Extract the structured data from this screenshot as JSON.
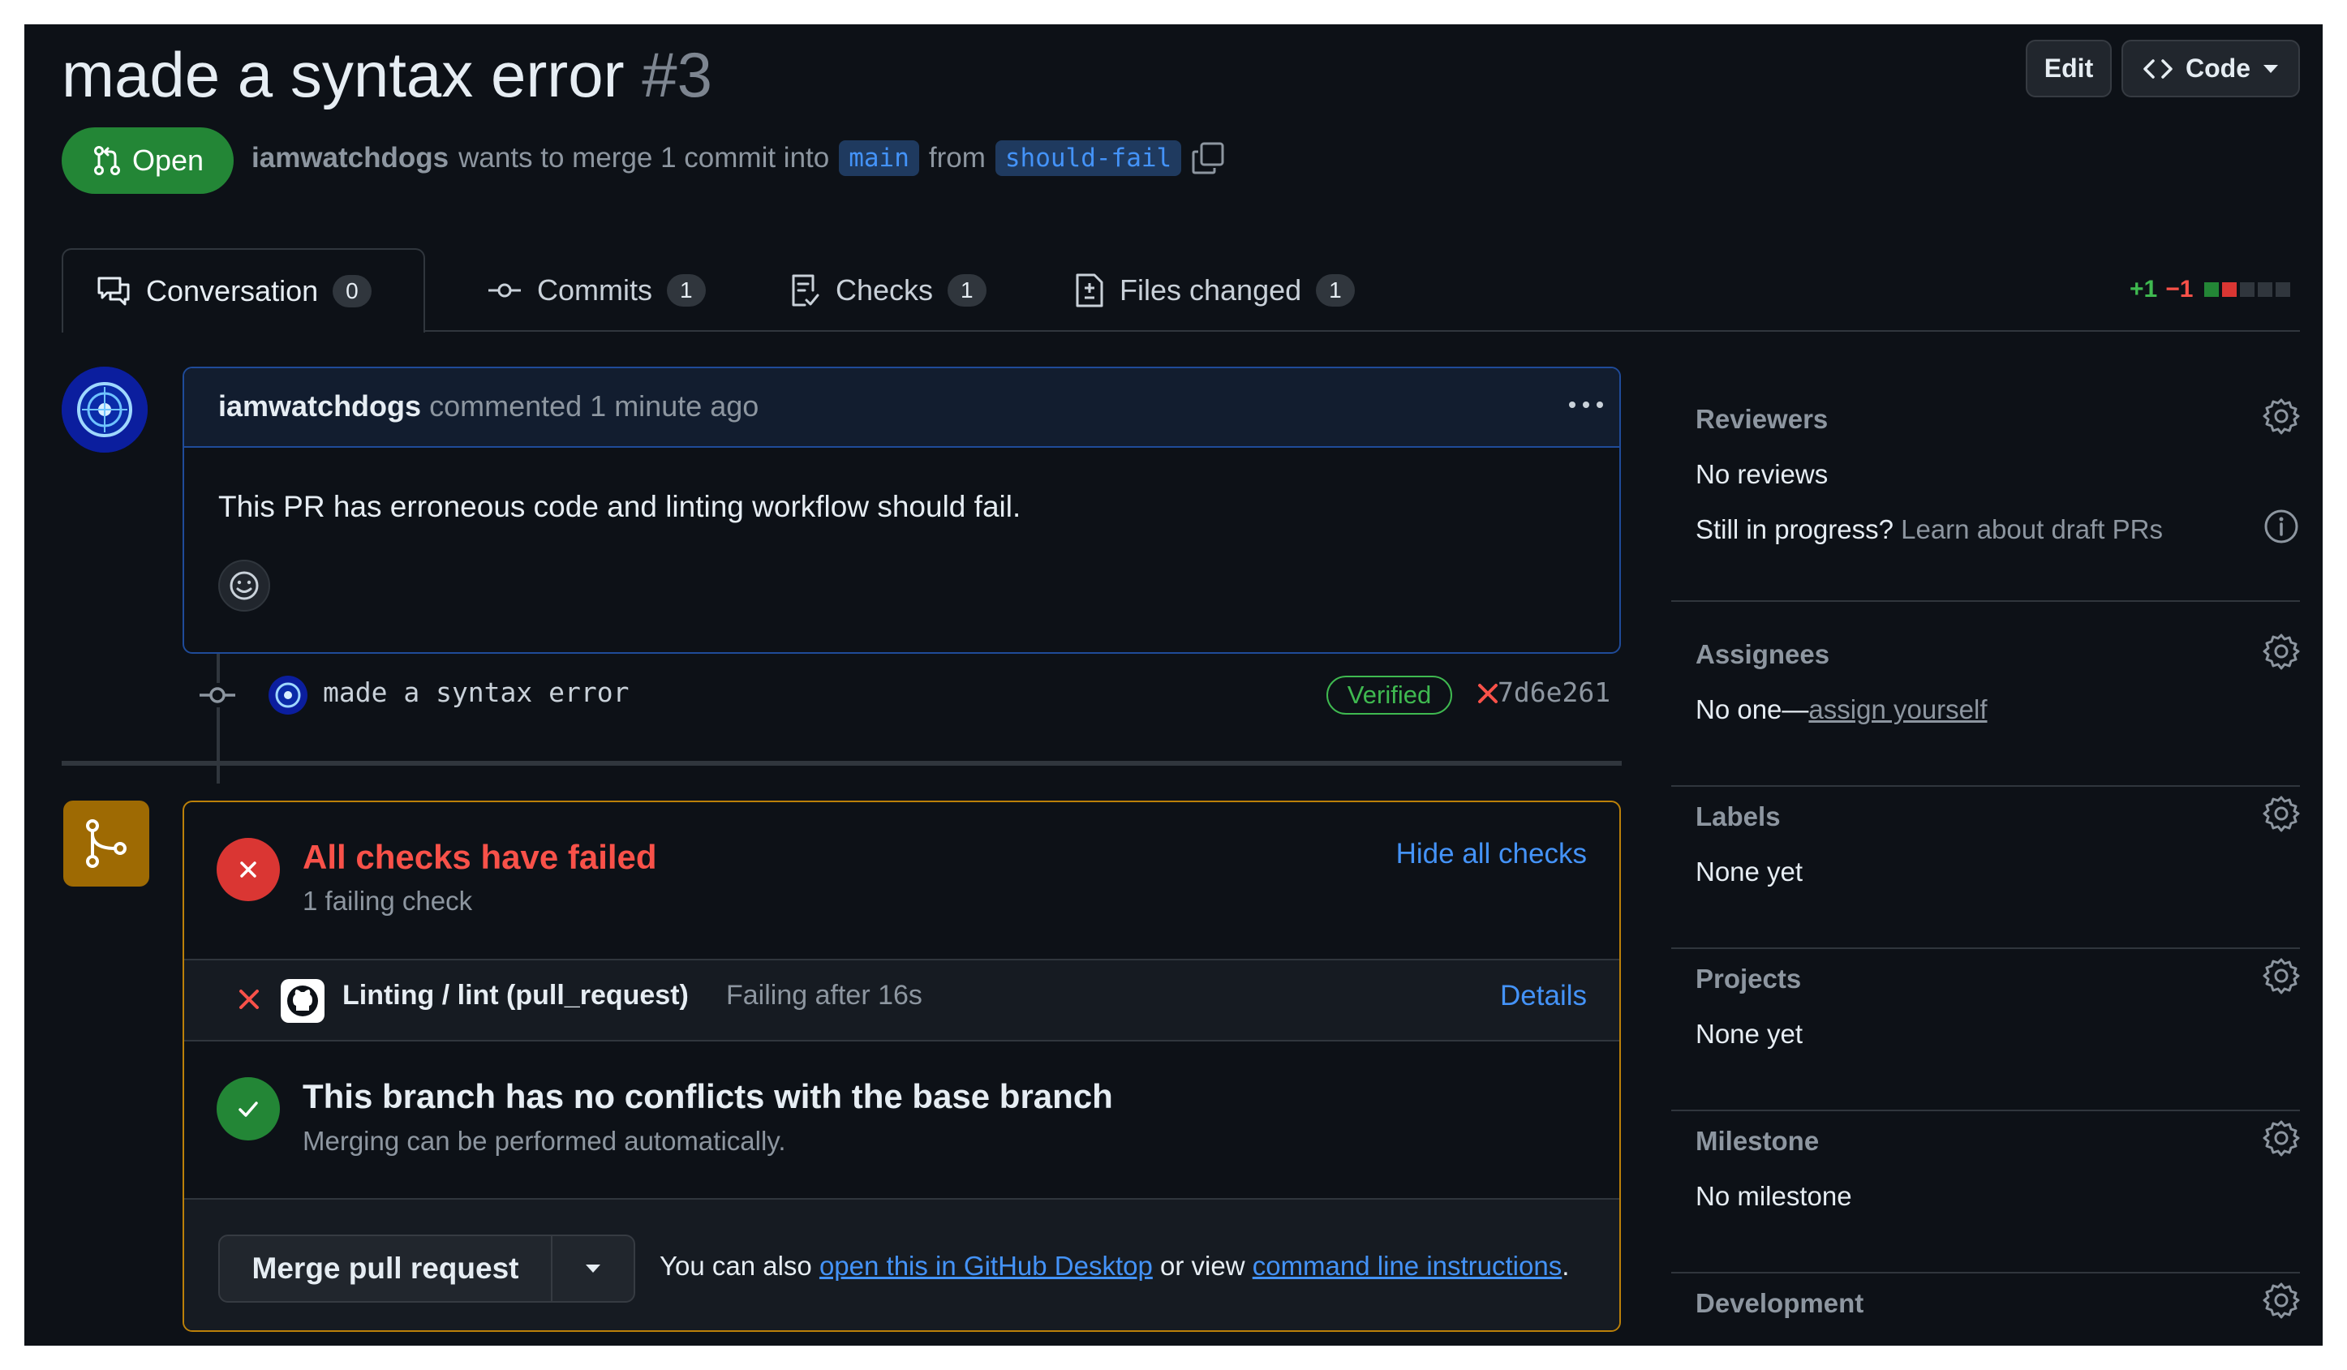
{
  "header": {
    "title": "made a syntax error",
    "number": "#3",
    "edit_label": "Edit",
    "code_label": "Code",
    "state": "Open",
    "author": "iamwatchdogs",
    "merge_text_1": "wants to merge 1 commit into",
    "base_branch": "main",
    "merge_text_2": "from",
    "head_branch": "should-fail"
  },
  "tabs": [
    {
      "label": "Conversation",
      "count": "0"
    },
    {
      "label": "Commits",
      "count": "1"
    },
    {
      "label": "Checks",
      "count": "1"
    },
    {
      "label": "Files changed",
      "count": "1"
    }
  ],
  "diffstat": {
    "additions": "+1",
    "deletions": "−1"
  },
  "comment": {
    "author": "iamwatchdogs",
    "meta": "commented 1 minute ago",
    "body": "This PR has erroneous code and linting workflow should fail."
  },
  "commit": {
    "message": "made a syntax error",
    "verified_label": "Verified",
    "sha": "7d6e261"
  },
  "merge_box": {
    "checks_title": "All checks have failed",
    "checks_sub": "1 failing check",
    "hide_checks": "Hide all checks",
    "check_name": "Linting / lint (pull_request)",
    "check_status": "Failing after 16s",
    "check_details": "Details",
    "noconf_title": "This branch has no conflicts with the base branch",
    "noconf_sub": "Merging can be performed automatically.",
    "merge_button": "Merge pull request",
    "hint_prefix": "You can also",
    "hint_link1": "open this in GitHub Desktop",
    "hint_middle": "or view",
    "hint_link2": "command line instructions",
    "hint_suffix": "."
  },
  "sidebar": {
    "reviewers": {
      "heading": "Reviewers",
      "value": "No reviews",
      "draft_q": "Still in progress?",
      "draft_link": "Learn about draft PRs"
    },
    "assignees": {
      "heading": "Assignees",
      "value": "No one—",
      "link": "assign yourself"
    },
    "labels": {
      "heading": "Labels",
      "value": "None yet"
    },
    "projects": {
      "heading": "Projects",
      "value": "None yet"
    },
    "milestone": {
      "heading": "Milestone",
      "value": "No milestone"
    },
    "development": {
      "heading": "Development"
    }
  },
  "colors": {
    "bg": "#0d1117",
    "open_green": "#238636",
    "fail_red": "#f85149",
    "success_green": "#3fb950",
    "link_blue": "#4493f8",
    "merge_border": "#bb8009"
  }
}
